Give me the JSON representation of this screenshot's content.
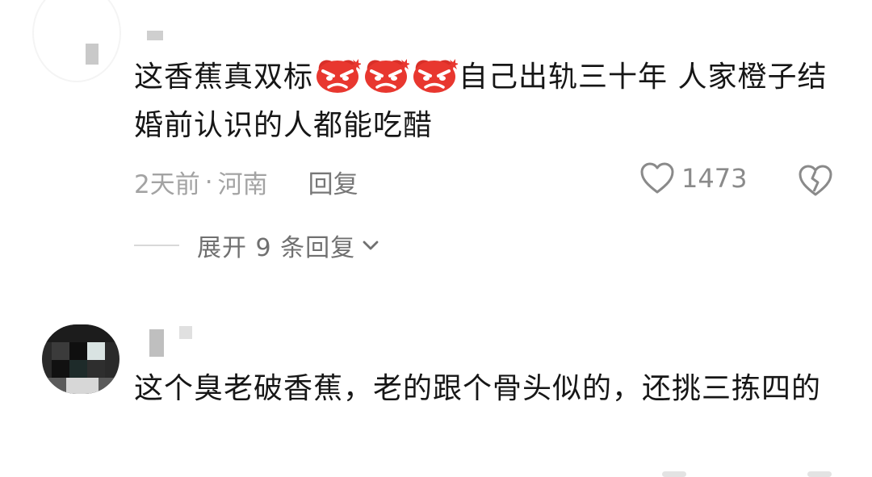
{
  "comments": [
    {
      "text_before": "这香蕉真双标",
      "emojis": [
        "angry-face-emoji",
        "angry-face-emoji",
        "angry-face-emoji"
      ],
      "text_after": "自己出轨三十年  人家橙子结婚前认识的人都能吃醋",
      "time": "2天前",
      "separator": "·",
      "location": "河南",
      "reply_label": "回复",
      "likes": "1473",
      "expand_label": "展开 9 条回复"
    },
    {
      "text": "这个臭老破香蕉，老的跟个骨头似的，还挑三拣四的"
    }
  ],
  "colors": {
    "text": "#161616",
    "meta": "#a3a3a3",
    "emoji": "#e8372f"
  }
}
